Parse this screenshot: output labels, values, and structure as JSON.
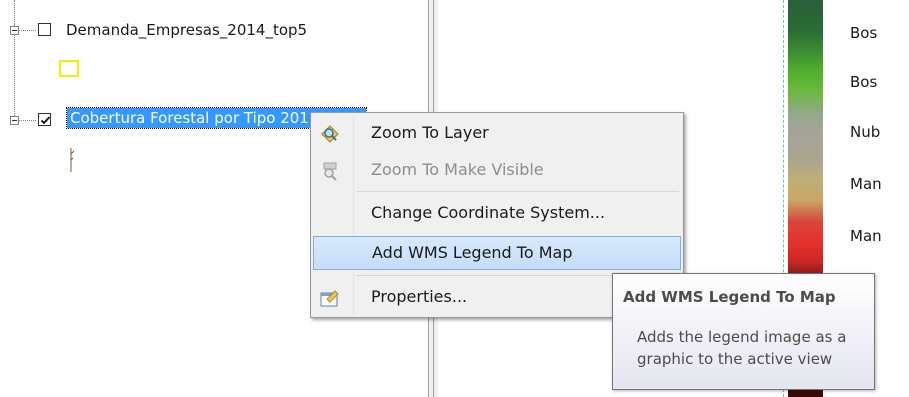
{
  "toc": {
    "layers": [
      {
        "name": "Demanda_Empresas_2014_top5",
        "checked": false,
        "symbol": "yellow-outline-square"
      },
      {
        "name": "Cobertura Forestal por Tipo 2012",
        "checked": true,
        "selected": true
      }
    ]
  },
  "context_menu": {
    "items": [
      {
        "label": "Zoom To Layer",
        "icon": "zoom-to-layer-icon",
        "enabled": true
      },
      {
        "label": "Zoom To Make Visible",
        "icon": "zoom-visible-icon",
        "enabled": false
      },
      {
        "label": "Change Coordinate System...",
        "icon": "",
        "enabled": true
      },
      {
        "label": "Add WMS Legend To Map",
        "icon": "",
        "enabled": true,
        "highlighted": true
      },
      {
        "label": "Properties...",
        "icon": "properties-icon",
        "enabled": true
      }
    ]
  },
  "tooltip": {
    "title": "Add WMS Legend To Map",
    "description": "Adds the legend image as a graphic to the active view"
  },
  "legend": {
    "labels": [
      "Bos",
      "Bos",
      "Nub",
      "Man",
      "Man"
    ],
    "ramp_colors": [
      "#2d5f3a",
      "#4fae2e",
      "#a7a399",
      "#c9a866",
      "#e52f2a",
      "#3a0a0a"
    ]
  }
}
